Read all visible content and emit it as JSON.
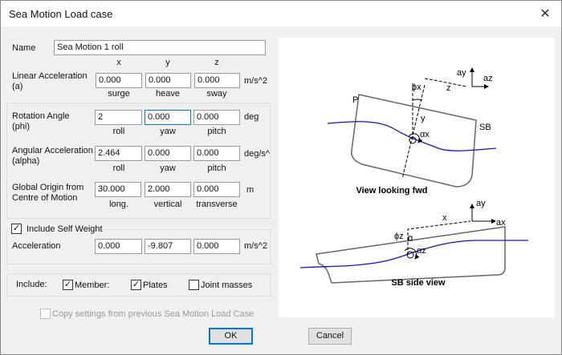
{
  "window": {
    "title": "Sea Motion Load case",
    "close_icon": "close-icon"
  },
  "name": {
    "label": "Name",
    "value": "Sea Motion 1 roll"
  },
  "axes": {
    "x": "x",
    "y": "y",
    "z": "z"
  },
  "linear": {
    "label": "Linear Acceleration\n(a)",
    "values": [
      "0.000",
      "0.000",
      "0.000"
    ],
    "unit": "m/s^2",
    "subs": [
      "surge",
      "heave",
      "sway"
    ]
  },
  "rotation": {
    "label": "Rotation Angle\n(phi)",
    "values": [
      "2",
      "0.000",
      "0.000"
    ],
    "unit": "deg",
    "subs": [
      "roll",
      "yaw",
      "pitch"
    ]
  },
  "angular": {
    "label": "Angular Acceleration\n(alpha)",
    "values": [
      "2.464",
      "0.000",
      "0.000"
    ],
    "unit": "deg/s^",
    "subs": [
      "roll",
      "yaw",
      "pitch"
    ]
  },
  "origin": {
    "label": "Global Origin from\nCentre of Motion",
    "values": [
      "30.000",
      "2.000",
      "0.000"
    ],
    "unit": "m",
    "subs": [
      "long.",
      "vertical",
      "transverse"
    ]
  },
  "self_weight": {
    "label": "Include Self Weight",
    "checked": true,
    "accel_label": "Acceleration",
    "values": [
      "0.000",
      "-9.807",
      "0.000"
    ],
    "unit": "m/s^2"
  },
  "include": {
    "label": "Include:",
    "members": {
      "label": "Member:",
      "checked": true
    },
    "plates": {
      "label": "Plates",
      "checked": true
    },
    "joints": {
      "label": "Joint masses",
      "checked": false
    }
  },
  "copy": {
    "label": "Copy settings from previous Sea Motion Load Case",
    "checked": false,
    "disabled": true
  },
  "buttons": {
    "ok": "OK",
    "cancel": "Cancel"
  },
  "diagram": {
    "view1": {
      "caption": "View looking fwd",
      "P": "P",
      "SB": "SB",
      "phi": "ϕx",
      "y": "y",
      "z": "z",
      "alpha": "αx",
      "ay": "ay",
      "az": "az"
    },
    "view2": {
      "caption": "SB side view",
      "phi": "ϕz",
      "x": "x",
      "alpha": "αz",
      "ay": "ay",
      "ax": "ax"
    },
    "wave_color": "#1010d0"
  }
}
